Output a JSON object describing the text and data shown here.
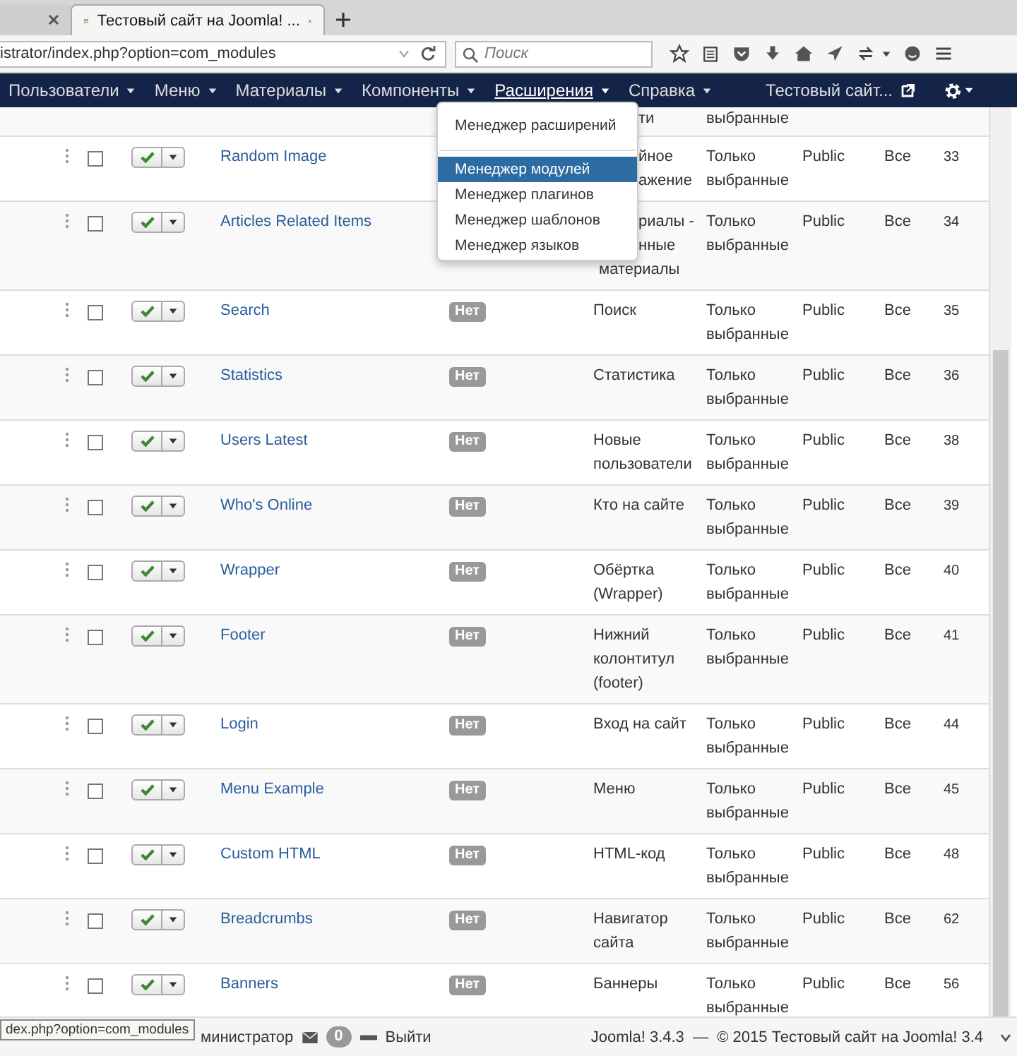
{
  "browser": {
    "tabs": [
      {
        "selected": false
      },
      {
        "title": "Тестовый сайт на Joomla! ...",
        "selected": true
      }
    ],
    "address": "istrator/index.php?option=com_modules",
    "search": {
      "placeholder": "Поиск"
    }
  },
  "navbar": {
    "items": [
      {
        "label": "Пользователи",
        "selected": false
      },
      {
        "label": "Меню",
        "selected": false
      },
      {
        "label": "Материалы",
        "selected": false
      },
      {
        "label": "Компоненты",
        "selected": false
      },
      {
        "label": "Расширения",
        "selected": true
      },
      {
        "label": "Справка",
        "selected": false
      }
    ],
    "site_link": "Тестовый сайт..."
  },
  "dropdown": {
    "items": [
      {
        "label": "Менеджер расширений",
        "selected": false,
        "kind": "item"
      },
      {
        "kind": "divider"
      },
      {
        "label": "Менеджер модулей",
        "selected": true,
        "kind": "item"
      },
      {
        "label": "Менеджер плагинов",
        "selected": false,
        "kind": "item"
      },
      {
        "label": "Менеджер шаблонов",
        "selected": false,
        "kind": "item"
      },
      {
        "label": "Менеджер языков",
        "selected": false,
        "kind": "item"
      }
    ]
  },
  "rows": [
    {
      "kind": "cut",
      "type": "ти",
      "type_cut": true,
      "pages": "выбранные"
    },
    {
      "kind": "full",
      "published": true,
      "checked": false,
      "title": "Random Image",
      "type": "йное\nажение",
      "type_cut": true,
      "pages": "Только выбранные",
      "access": "Public",
      "assigned": "Все",
      "id": "33"
    },
    {
      "kind": "full",
      "published": true,
      "checked": false,
      "title": "Articles Related Items",
      "type": "риалы -\nнные\nматериалы",
      "type_cut": true,
      "pages": "Только выбранные",
      "access": "Public",
      "assigned": "Все",
      "id": "34"
    },
    {
      "kind": "full",
      "published": true,
      "checked": false,
      "title": "Search",
      "position": "Нет",
      "type": "Поиск",
      "type_cut": false,
      "pages": "Только выбранные",
      "access": "Public",
      "assigned": "Все",
      "id": "35"
    },
    {
      "kind": "full",
      "published": true,
      "checked": false,
      "title": "Statistics",
      "position": "Нет",
      "type": "Статистика",
      "type_cut": false,
      "pages": "Только выбранные",
      "access": "Public",
      "assigned": "Все",
      "id": "36"
    },
    {
      "kind": "full",
      "published": true,
      "checked": false,
      "title": "Users Latest",
      "position": "Нет",
      "type": "Новые\nпользователи",
      "type_cut": false,
      "pages": "Только выбранные",
      "access": "Public",
      "assigned": "Все",
      "id": "38"
    },
    {
      "kind": "full",
      "published": true,
      "checked": false,
      "title": "Who's Online",
      "position": "Нет",
      "type": "Кто на сайте",
      "type_cut": false,
      "pages": "Только выбранные",
      "access": "Public",
      "assigned": "Все",
      "id": "39"
    },
    {
      "kind": "full",
      "published": true,
      "checked": false,
      "title": "Wrapper",
      "position": "Нет",
      "type": "Обёртка\n(Wrapper)",
      "type_cut": false,
      "pages": "Только выбранные",
      "access": "Public",
      "assigned": "Все",
      "id": "40"
    },
    {
      "kind": "full",
      "published": true,
      "checked": false,
      "title": "Footer",
      "position": "Нет",
      "type": "Нижний\nколонтитул\n(footer)",
      "type_cut": false,
      "pages": "Только выбранные",
      "access": "Public",
      "assigned": "Все",
      "id": "41"
    },
    {
      "kind": "full",
      "published": true,
      "checked": false,
      "title": "Login",
      "position": "Нет",
      "type": "Вход на сайт",
      "type_cut": false,
      "pages": "Только выбранные",
      "access": "Public",
      "assigned": "Все",
      "id": "44"
    },
    {
      "kind": "full",
      "published": true,
      "checked": false,
      "title": "Menu Example",
      "position": "Нет",
      "type": "Меню",
      "type_cut": false,
      "pages": "Только выбранные",
      "access": "Public",
      "assigned": "Все",
      "id": "45"
    },
    {
      "kind": "full",
      "published": true,
      "checked": false,
      "title": "Custom HTML",
      "position": "Нет",
      "type": "HTML-код",
      "type_cut": false,
      "pages": "Только выбранные",
      "access": "Public",
      "assigned": "Все",
      "id": "48"
    },
    {
      "kind": "full",
      "published": true,
      "checked": false,
      "title": "Breadcrumbs",
      "position": "Нет",
      "type": "Навигатор\nсайта",
      "type_cut": false,
      "pages": "Только выбранные",
      "access": "Public",
      "assigned": "Все",
      "id": "62"
    },
    {
      "kind": "full",
      "published": true,
      "checked": false,
      "title": "Banners",
      "position": "Нет",
      "type": "Баннеры",
      "type_cut": false,
      "pages": "Только выбранные",
      "access": "Public",
      "assigned": "Все",
      "id": "56"
    }
  ],
  "status_bar": {
    "user": "министратор",
    "messages": "0",
    "logout": "Выйти",
    "footer": "Joomla! 3.4.3  —  © 2015 Тестовый сайт на Joomla! 3.4",
    "link_preview": "dex.php?option=com_modules"
  }
}
